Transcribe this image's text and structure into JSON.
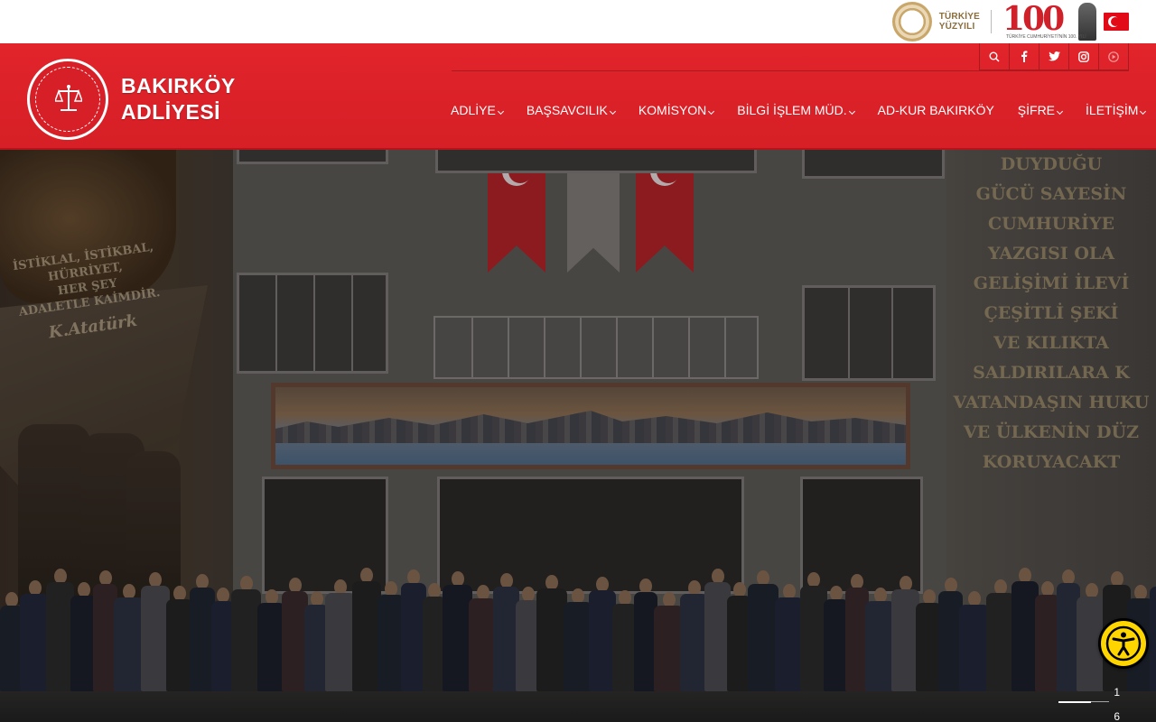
{
  "topbar": {
    "yuzyil_line1": "TÜRKİYE",
    "yuzyil_line2": "YÜZYILI",
    "logo100_number": "100",
    "logo100_caption": "TÜRKİYE CUMHURİYETİ'NİN 100. YILI"
  },
  "header": {
    "brand_line1": "BAKIRKÖY",
    "brand_line2": "ADLİYESİ",
    "social": [
      {
        "icon": "search-icon"
      },
      {
        "icon": "facebook-icon"
      },
      {
        "icon": "twitter-icon"
      },
      {
        "icon": "instagram-icon"
      },
      {
        "icon": "youtube-icon"
      }
    ],
    "nav": [
      {
        "label": "ADLİYE",
        "has_dropdown": true
      },
      {
        "label": "BAŞSAVCILIK",
        "has_dropdown": true
      },
      {
        "label": "KOMİSYON",
        "has_dropdown": true
      },
      {
        "label": "BİLGİ İŞLEM MÜD.",
        "has_dropdown": true
      },
      {
        "label": "AD-KUR BAKIRKÖY",
        "has_dropdown": false
      },
      {
        "label": "ŞİFRE",
        "has_dropdown": true
      },
      {
        "label": "İLETİŞİM",
        "has_dropdown": true
      }
    ]
  },
  "hero": {
    "plaque_left": [
      "İSTİKLAL, İSTİKBAL,",
      "HÜRRİYET,",
      "HER ŞEY",
      "ADALETLE KAİMDİR.",
      "K.Atatürk"
    ],
    "wall_text_right": [
      "DUYDUĞU",
      "GÜCÜ SAYESİN",
      "CUMHURİYE",
      "YAZGISI OLA",
      "GELİŞİMİ İLEVİ",
      "ÇEŞİTLİ ŞEKİ",
      "VE KILIKTA",
      "SALDIRILARA K",
      "VATANDAŞIN HUKU",
      "VE ÜLKENİN DÜZ",
      "KORUYACAKT"
    ],
    "slider_current": "1",
    "slider_total": "6"
  },
  "colors": {
    "header_red": "#d61f26",
    "accessibility_yellow": "#ffd500"
  }
}
